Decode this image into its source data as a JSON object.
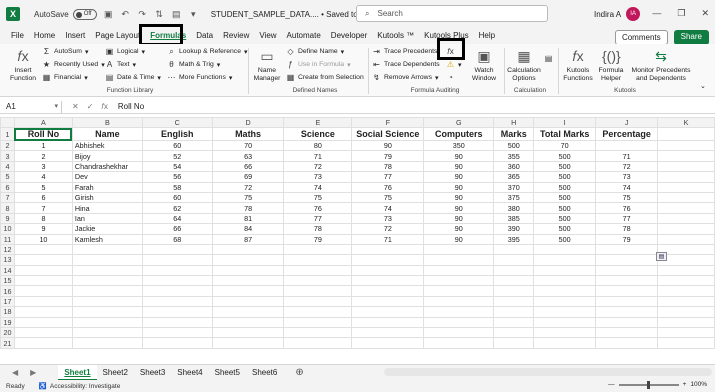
{
  "titlebar": {
    "logo": "X",
    "autosave_label": "AutoSave",
    "autosave_state": "Off",
    "doc_title": "STUDENT_SAMPLE_DATA.... • Saved to this PC",
    "search_placeholder": "Search",
    "user_name": "Indira A",
    "user_initials": "IA"
  },
  "menu_tabs": [
    "File",
    "Home",
    "Insert",
    "Page Layout",
    "Formulas",
    "Data",
    "Review",
    "View",
    "Automate",
    "Developer",
    "Kutools ™",
    "Kutools Plus",
    "Help"
  ],
  "active_tab": "Formulas",
  "actions": {
    "comments": "Comments",
    "share": "Share"
  },
  "ribbon": {
    "function_library": {
      "label": "Function Library",
      "insert_function": "Insert Function",
      "autosum": "AutoSum",
      "recently_used": "Recently Used",
      "financial": "Financial",
      "logical": "Logical",
      "text": "Text",
      "date_time": "Date & Time",
      "lookup": "Lookup & Reference",
      "math": "Math & Trig",
      "more": "More Functions"
    },
    "defined_names": {
      "label": "Defined Names",
      "name_manager": "Name Manager",
      "define_name": "Define Name",
      "use_in_formula": "Use in Formula",
      "create_from_selection": "Create from Selection"
    },
    "formula_auditing": {
      "label": "Formula Auditing",
      "trace_precedents": "Trace Precedents",
      "trace_dependents": "Trace Dependents",
      "remove_arrows": "Remove Arrows",
      "watch_window": "Watch Window"
    },
    "calculation": {
      "label": "Calculation",
      "options": "Calculation Options"
    },
    "kutools": {
      "label": "Kutools",
      "functions": "Kutools Functions",
      "formula_helper": "Formula Helper",
      "monitor": "Monitor Precedents and Dependents"
    }
  },
  "formula_bar": {
    "cell": "A1",
    "value": "Roll No"
  },
  "columns": [
    "A",
    "B",
    "C",
    "D",
    "E",
    "F",
    "G",
    "H",
    "I",
    "J",
    "K"
  ],
  "headers": [
    "Roll No",
    "Name",
    "English",
    "Maths",
    "Science",
    "Social Science",
    "Computers",
    "Marks",
    "Total Marks",
    "Percentage"
  ],
  "rows": [
    [
      "1",
      "Abhishek",
      "60",
      "70",
      "80",
      "90",
      "350",
      "500",
      "70"
    ],
    [
      "2",
      "Bijoy",
      "52",
      "63",
      "71",
      "79",
      "90",
      "355",
      "500",
      "71"
    ],
    [
      "3",
      "Chandrashekhar",
      "54",
      "66",
      "72",
      "78",
      "90",
      "360",
      "500",
      "72"
    ],
    [
      "4",
      "Dev",
      "56",
      "69",
      "73",
      "77",
      "90",
      "365",
      "500",
      "73"
    ],
    [
      "5",
      "Farah",
      "58",
      "72",
      "74",
      "76",
      "90",
      "370",
      "500",
      "74"
    ],
    [
      "6",
      "Girish",
      "60",
      "75",
      "75",
      "75",
      "90",
      "375",
      "500",
      "75"
    ],
    [
      "7",
      "Hina",
      "62",
      "78",
      "76",
      "74",
      "90",
      "380",
      "500",
      "76"
    ],
    [
      "8",
      "Ian",
      "64",
      "81",
      "77",
      "73",
      "90",
      "385",
      "500",
      "77"
    ],
    [
      "9",
      "Jackie",
      "66",
      "84",
      "78",
      "72",
      "90",
      "390",
      "500",
      "78"
    ],
    [
      "10",
      "Kamlesh",
      "68",
      "87",
      "79",
      "71",
      "90",
      "395",
      "500",
      "79"
    ]
  ],
  "row_numbers": [
    "1",
    "2",
    "3",
    "4",
    "5",
    "6",
    "7",
    "8",
    "9",
    "10",
    "11",
    "12",
    "13",
    "14",
    "15",
    "16",
    "17",
    "18",
    "19",
    "20",
    "21"
  ],
  "sheets": [
    "Sheet1",
    "Sheet2",
    "Sheet3",
    "Sheet4",
    "Sheet5",
    "Sheet6"
  ],
  "active_sheet": "Sheet1",
  "status": {
    "ready": "Ready",
    "accessibility": "Accessibility: Investigate",
    "zoom": "100%"
  }
}
